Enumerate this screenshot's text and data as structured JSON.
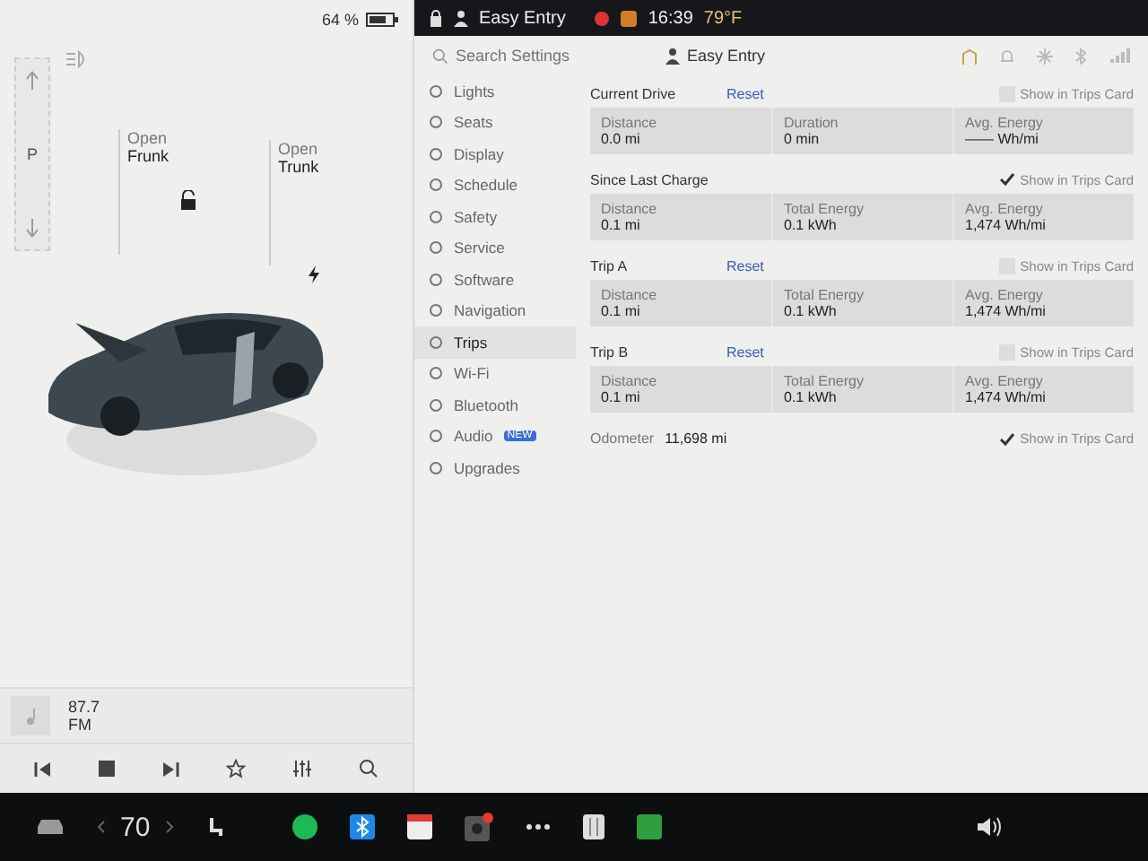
{
  "status_bar": {
    "battery": "64 %",
    "profile": "Easy Entry",
    "time": "16:39",
    "temperature": "79°F"
  },
  "car_panel": {
    "gear": "P",
    "frunk": {
      "action": "Open",
      "part": "Frunk"
    },
    "trunk": {
      "action": "Open",
      "part": "Trunk"
    }
  },
  "media": {
    "station": "87.7",
    "band": "FM"
  },
  "settings": {
    "search": {
      "placeholder": "Search Settings"
    },
    "profile": "Easy Entry",
    "menu": [
      {
        "label": "Lights",
        "selected": false
      },
      {
        "label": "Seats",
        "selected": false
      },
      {
        "label": "Display",
        "selected": false
      },
      {
        "label": "Schedule",
        "selected": false
      },
      {
        "label": "Safety",
        "selected": false
      },
      {
        "label": "Service",
        "selected": false
      },
      {
        "label": "Software",
        "selected": false
      },
      {
        "label": "Navigation",
        "selected": false
      },
      {
        "label": "Trips",
        "selected": true
      },
      {
        "label": "Wi-Fi",
        "selected": false
      },
      {
        "label": "Bluetooth",
        "selected": false
      },
      {
        "label": "Audio",
        "selected": false,
        "badge": "NEW"
      },
      {
        "label": "Upgrades",
        "selected": false
      }
    ]
  },
  "trips": [
    {
      "title": "Current Drive",
      "reset": "Reset",
      "show_in_card": {
        "label": "Show in Trips Card",
        "checked": false
      },
      "stats": [
        {
          "label": "Distance",
          "value": "0.0 mi"
        },
        {
          "label": "Duration",
          "value": "0 min"
        },
        {
          "label": "Avg. Energy",
          "value": "—— Wh/mi"
        }
      ]
    },
    {
      "title": "Since Last Charge",
      "show_in_card": {
        "label": "Show in Trips Card",
        "checked": true
      },
      "stats": [
        {
          "label": "Distance",
          "value": "0.1 mi"
        },
        {
          "label": "Total Energy",
          "value": "0.1 kWh"
        },
        {
          "label": "Avg. Energy",
          "value": "1,474 Wh/mi"
        }
      ]
    },
    {
      "title": "Trip A",
      "reset": "Reset",
      "show_in_card": {
        "label": "Show in Trips Card",
        "checked": false
      },
      "stats": [
        {
          "label": "Distance",
          "value": "0.1 mi"
        },
        {
          "label": "Total Energy",
          "value": "0.1 kWh"
        },
        {
          "label": "Avg. Energy",
          "value": "1,474 Wh/mi"
        }
      ]
    },
    {
      "title": "Trip B",
      "reset": "Reset",
      "show_in_card": {
        "label": "Show in Trips Card",
        "checked": false
      },
      "stats": [
        {
          "label": "Distance",
          "value": "0.1 mi"
        },
        {
          "label": "Total Energy",
          "value": "0.1 kWh"
        },
        {
          "label": "Avg. Energy",
          "value": "1,474 Wh/mi"
        }
      ]
    }
  ],
  "odometer": {
    "label": "Odometer",
    "value": "11,698 mi",
    "show_in_card": {
      "label": "Show in Trips Card",
      "checked": true
    }
  },
  "dock": {
    "temperature": "70"
  }
}
